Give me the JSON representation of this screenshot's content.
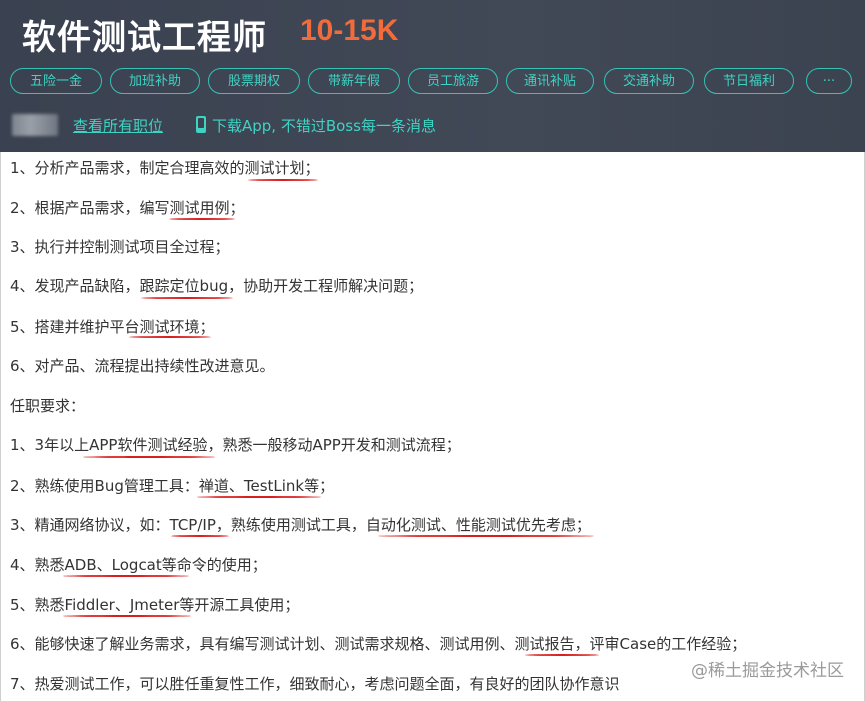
{
  "header": {
    "job_title": "软件测试工程师",
    "salary": "10-15K",
    "benefit_tags": [
      "五险一金",
      "加班补助",
      "股票期权",
      "带薪年假",
      "员工旅游",
      "通讯补贴",
      "交通补助",
      "节日福利",
      "···"
    ],
    "all_jobs_link": "查看所有职位",
    "app_promo": "下载App, 不错过Boss每一条消息"
  },
  "description": {
    "lines": [
      "1、分析产品需求，制定合理高效的测试计划；",
      "2、根据产品需求，编写测试用例；",
      "3、执行并控制测试项目全过程；",
      "4、发现产品缺陷，跟踪定位bug，协助开发工程师解决问题；",
      "5、搭建并维护平台测试环境；",
      "6、对产品、流程提出持续性改进意见。",
      "任职要求：",
      "1、3年以上APP软件测试经验，熟悉一般移动APP开发和测试流程；",
      "2、熟练使用Bug管理工具：禅道、TestLink等；",
      "3、精通网络协议，如：TCP/IP，熟练使用测试工具，自动化测试、性能测试优先考虑；",
      "4、熟悉ADB、Logcat等命令的使用；",
      "5、熟悉Fiddler、Jmeter等开源工具使用；",
      "6、能够快速了解业务需求，具有编写测试计划、测试需求规格、测试用例、测试报告，评审Case的工作经验；",
      "7、热爱测试工作，可以胜任重复性工作，细致耐心，考虑问题全面，有良好的团队协作意识"
    ]
  },
  "watermark": "@稀土掘金技术社区",
  "colors": {
    "header_bg": "#3b4252",
    "salary": "#f26b3a",
    "accent_teal": "#3ed3c3",
    "annotation_red": "#d91e1e"
  }
}
